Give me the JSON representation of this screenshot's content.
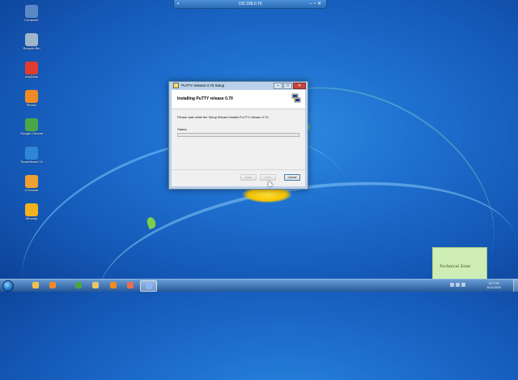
{
  "remote_bar": {
    "title": "192.168.0.70"
  },
  "desktop_icons": [
    {
      "name": "computer",
      "label": "Computer",
      "color": "#5a88c6"
    },
    {
      "name": "recycle-bin",
      "label": "Recycle Bin",
      "color": "#9fb6c9"
    },
    {
      "name": "anydesk",
      "label": "AnyDesk",
      "color": "#e23c30"
    },
    {
      "name": "firefox",
      "label": "Firefox",
      "color": "#f08a24"
    },
    {
      "name": "google-chrome",
      "label": "Google Chrome",
      "color": "#4aa548"
    },
    {
      "name": "teamviewer",
      "label": "TeamViewer 13",
      "color": "#2f86d6"
    },
    {
      "name": "ccleaner",
      "label": "CCleaner",
      "color": "#f0a030"
    },
    {
      "name": "vlc",
      "label": "Winamp",
      "color": "#f2b11f"
    }
  ],
  "dialog": {
    "title": "PuTTY release 0.70 Setup",
    "heading": "Installing PuTTY release 0.70",
    "message": "Please wait while the Setup Wizard installs PuTTY release 0.70.",
    "status_label": "Status:",
    "progress": 0.0,
    "buttons": {
      "back": "Back",
      "next": "Next",
      "cancel": "Cancel"
    },
    "window_controls": {
      "minimize": "–",
      "maximize": "□",
      "close": "✕"
    }
  },
  "watermark": {
    "text": "Technical Zone"
  },
  "taskbar": {
    "apps": [
      {
        "name": "explorer",
        "color": "#f2c14e"
      },
      {
        "name": "media-player",
        "color": "#f08a24"
      },
      {
        "name": "google-chrome",
        "color": "#4aa548"
      },
      {
        "name": "file-explorer",
        "color": "#e9c46a"
      },
      {
        "name": "firefox",
        "color": "#f08a24"
      },
      {
        "name": "paint",
        "color": "#e76f51"
      },
      {
        "name": "putty-setup",
        "color": "#8ab4f8"
      }
    ],
    "clock": {
      "time": "3:27 PM",
      "date": "10/11/2018"
    }
  },
  "colors": {
    "progress_fill": "#06b025",
    "dialog_frame": "#b9d1ea"
  }
}
